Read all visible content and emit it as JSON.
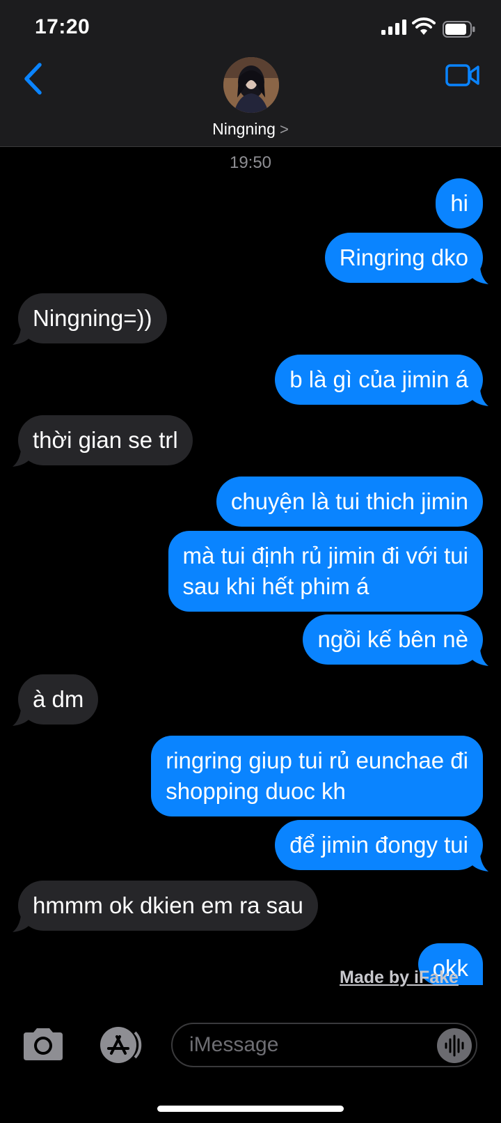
{
  "status_bar": {
    "time": "17:20"
  },
  "header": {
    "contact_name": "Ningning",
    "chevron": ">"
  },
  "chat": {
    "timestamp": "19:50",
    "messages": [
      {
        "dir": "out",
        "text": "hi"
      },
      {
        "dir": "out",
        "text": "Ringring dko"
      },
      {
        "dir": "in",
        "text": "Ningning=))"
      },
      {
        "dir": "out",
        "text": "b là gì của jimin á"
      },
      {
        "dir": "in",
        "text": "thời gian se trl"
      },
      {
        "dir": "out",
        "text": "chuyện là tui thich jimin"
      },
      {
        "dir": "out",
        "text": "mà tui định rủ jimin đi với tui\nsau khi hết phim á"
      },
      {
        "dir": "out",
        "text": "ngồi kế bên nè"
      },
      {
        "dir": "in",
        "text": "à dm"
      },
      {
        "dir": "out",
        "text": "ringring giup tui rủ eunchae đi\nshopping duoc kh"
      },
      {
        "dir": "out",
        "text": "để jimin đongy tui"
      },
      {
        "dir": "in",
        "text": "hmmm ok dkien em ra sau"
      },
      {
        "dir": "out",
        "text": "okk"
      }
    ]
  },
  "watermark": {
    "prefix": "Made by ",
    "brand": "iFake"
  },
  "composer": {
    "placeholder": "iMessage"
  },
  "colors": {
    "outgoing_bubble": "#0a84ff",
    "incoming_bubble": "#262629",
    "accent": "#0a84ff",
    "header_bg": "#1c1c1e",
    "background": "#000000"
  },
  "icons": [
    "back-chevron-icon",
    "video-call-icon",
    "camera-icon",
    "app-store-icon",
    "audio-waveform-icon",
    "signal-icon",
    "wifi-icon",
    "battery-icon"
  ]
}
